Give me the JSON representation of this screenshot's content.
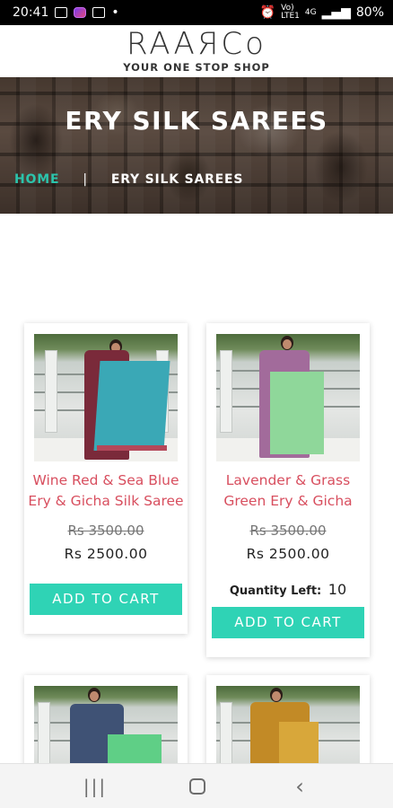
{
  "status_bar": {
    "time": "20:41",
    "network": "4G",
    "battery": "80%"
  },
  "header": {
    "logo": "RAAЯCo",
    "tagline": "YOUR ONE STOP SHOP"
  },
  "banner": {
    "title": "ERY SILK SAREES",
    "breadcrumb_home": "HOME",
    "breadcrumb_separator": "|",
    "breadcrumb_current": "ERY SILK SAREES"
  },
  "products": [
    {
      "name": "Wine Red & Sea Blue Ery & Gicha Silk Saree",
      "old_price": "Rs 3500.00",
      "new_price": "Rs 2500.00",
      "quantity_label": "",
      "quantity_value": "",
      "button": "ADD TO CART",
      "colors": {
        "body": "#7a2a3a",
        "drape": "#3aa8b6"
      }
    },
    {
      "name": "Lavender & Grass Green Ery & Gicha",
      "old_price": "Rs 3500.00",
      "new_price": "Rs 2500.00",
      "quantity_label": "Quantity Left:",
      "quantity_value": "10",
      "button": "ADD TO CART",
      "colors": {
        "body": "#a26b9b",
        "drape": "#8fd79a"
      }
    },
    {
      "colors": {
        "body": "#3f5275",
        "drape": "#5fcf86"
      }
    },
    {
      "colors": {
        "body": "#c28a26",
        "drape": "#d8a73a"
      }
    }
  ],
  "accent_color": "#2fd3b5",
  "product_name_color": "#d84f5f"
}
